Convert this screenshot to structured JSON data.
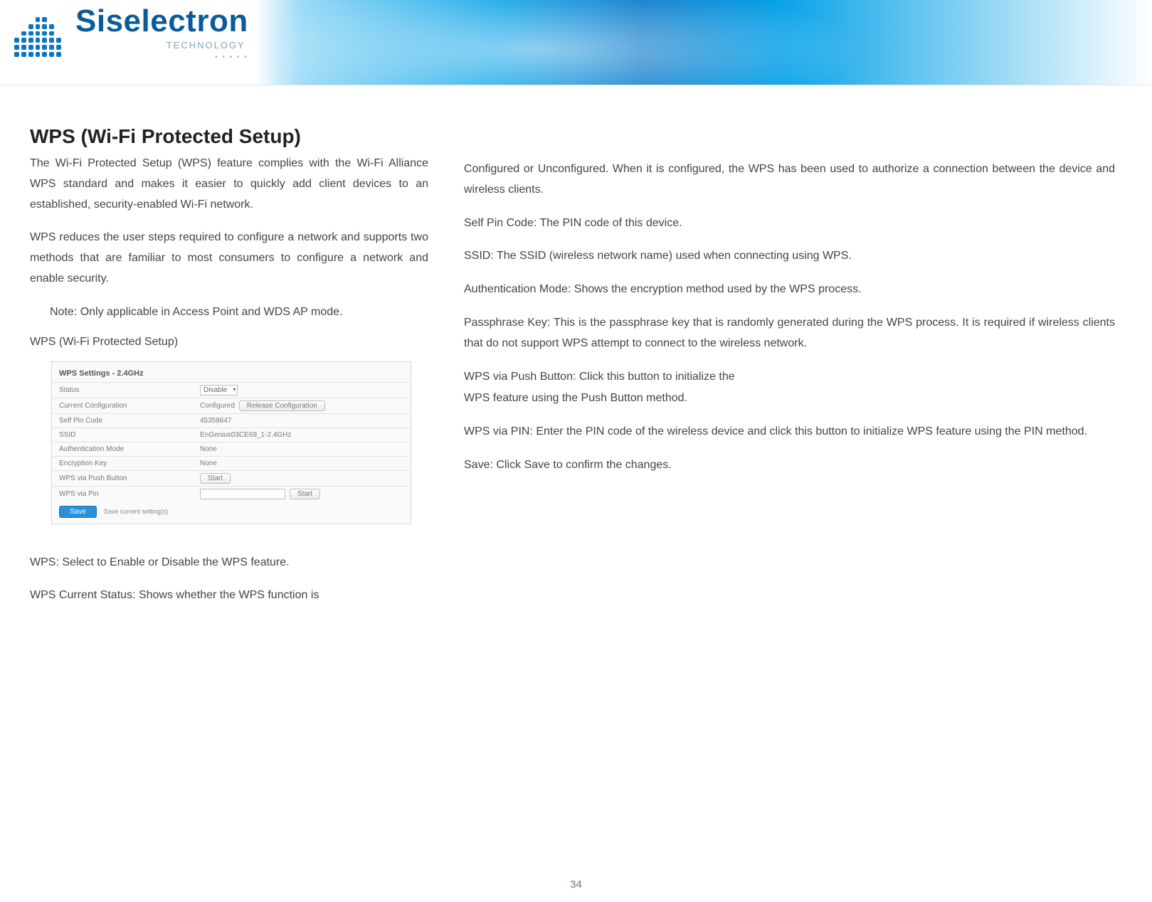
{
  "brand": {
    "name": "Siselectron",
    "sub": "TECHNOLOGY"
  },
  "title": {
    "main": "WPS (Wi-Fi ",
    "bold": "Protected",
    "tail": " Setup)"
  },
  "left": {
    "p1": "The  Wi-Fi  Protected  Setup   (WPS)  feature  complies   with  the  Wi-Fi  Alliance  WPS standard  and   makes    it  easier  to   quickly  add  client   devices  to  an  established, security-enabled Wi-Fi network.",
    "p2": "WPS  reduces  the   user   steps  required    to   configure  a  network  and supports   two    methods  that    are   familiar   to   most consumers to  configure a network and  enable security.",
    "note": "Note:   Only  applicable   in  Access   Point   and   WDS AP mode.",
    "subhead": "WPS (Wi-Fi Protected  Setup)",
    "pWpsSelect": "WPS: Select  to  Enable or Disable the  WPS feature.",
    "pWpsCurrent": "WPS Current Status:  Shows  whether the  WPS function  is"
  },
  "right": {
    "p1": "Configured  or  Unconfigured.  When   it   is  configured,   the WPS  has been    used    to   authorize  a  connection  between   the  device   and wireless clients.",
    "p2": "Self  Pin  Code:  The PIN code  of this  device.",
    "p3": "SSID:   The    SSID  (wireless    network    name)    used    when connecting   using  WPS.",
    "p4": "Authentication Mode:  Shows   the   encryption method  used  by  the  WPS process.",
    "p5": "Passphrase  Key:   This   is   the   passphrase  key   that   is   randomly   generated during   the   WPS  process.   It  is  required   if wireless  clients   that  do   not   support  WPS  attempt  to   connect  to   the  wireless   network.",
    "p6a": "WPS  via  Push   Button:  Click this   button  to   initialize   the",
    "p6b": "WPS feature using  the  Push Button method.",
    "p7": "WPS  via   PIN:  Enter   the   PIN code   of  the   wireless  device and  click this  button to  initialize  WPS feature using  the  PIN method.",
    "p8": "Save: Click Save to confirm the changes."
  },
  "settings": {
    "heading": "WPS Settings - 2.4GHz",
    "rows": {
      "status_lbl": "Status",
      "status_val": "Disable",
      "cfg_lbl": "Current Configuration",
      "cfg_val": "Configured",
      "cfg_btn": "Release Configuration",
      "pin_lbl": "Self Pin Code",
      "pin_val": "45358647",
      "ssid_lbl": "SSID",
      "ssid_val": "EnGenius03CE69_1-2.4GHz",
      "auth_lbl": "Authentication Mode",
      "auth_val": "None",
      "enc_lbl": "Encryption Key",
      "enc_val": "None",
      "push_lbl": "WPS via Push Button",
      "push_btn": "Start",
      "wpin_lbl": "WPS via Pin",
      "wpin_btn": "Start"
    },
    "save_btn": "Save",
    "save_note": "Save current setting(s)"
  },
  "page_num": "34"
}
